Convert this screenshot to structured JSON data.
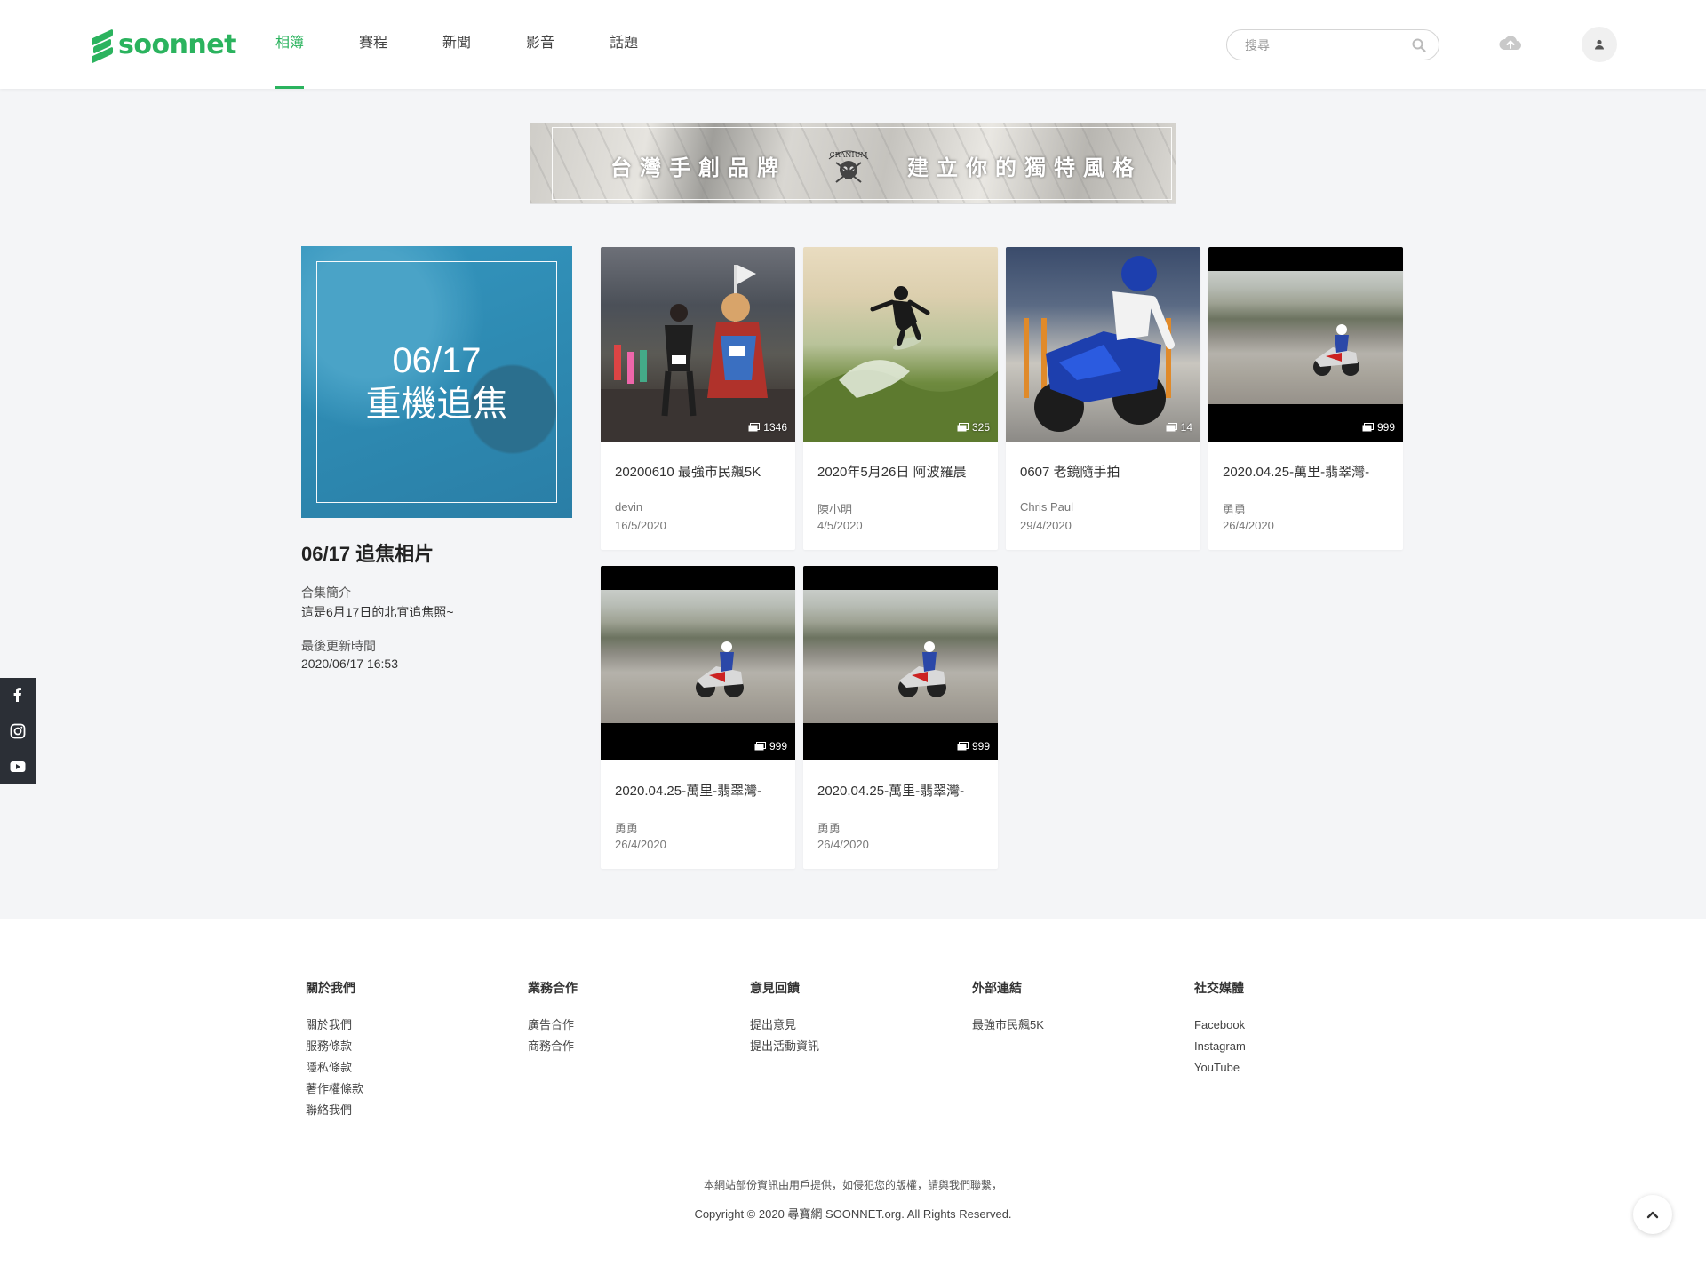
{
  "header": {
    "logo_text": "soonnet",
    "nav": [
      "相簿",
      "賽程",
      "新聞",
      "影音",
      "話題"
    ],
    "active_nav": "相簿",
    "search_placeholder": "搜尋",
    "accent_color": "#2bb35e"
  },
  "banner": {
    "left_text": "台灣手創品牌",
    "right_text": "建立你的獨特風格",
    "logo_text": "CRANIUM"
  },
  "album": {
    "cover_line1": "06/17",
    "cover_line2": "重機追焦",
    "title": "06/17 追焦相片",
    "intro_label": "合集簡介",
    "intro_text": "這是6月17日的北宜追焦照~",
    "updated_label": "最後更新時間",
    "updated_value": "2020/06/17 16:53"
  },
  "cards": [
    {
      "title": "20200610 最強市民飆5K",
      "author": "devin",
      "date": "16/5/2020",
      "count": "1346"
    },
    {
      "title": "2020年5月26日 阿波羅晨",
      "author": "陳小明",
      "date": "4/5/2020",
      "count": "325"
    },
    {
      "title": "0607 老鏡隨手拍",
      "author": "Chris Paul",
      "date": "29/4/2020",
      "count": "14"
    },
    {
      "title": "2020.04.25-萬里-翡翠灣-",
      "author": "勇勇",
      "date": "26/4/2020",
      "count": "999"
    },
    {
      "title": "2020.04.25-萬里-翡翠灣-",
      "author": "勇勇",
      "date": "26/4/2020",
      "count": "999"
    },
    {
      "title": "2020.04.25-萬里-翡翠灣-",
      "author": "勇勇",
      "date": "26/4/2020",
      "count": "999"
    }
  ],
  "social_sidebar": [
    "facebook-icon",
    "instagram-icon",
    "youtube-icon"
  ],
  "footer": {
    "columns": [
      {
        "heading": "關於我們",
        "links": [
          "關於我們",
          "服務條款",
          "隱私條款",
          "著作權條款",
          "聯絡我們"
        ]
      },
      {
        "heading": "業務合作",
        "links": [
          "廣告合作",
          "商務合作"
        ]
      },
      {
        "heading": "意見回饋",
        "links": [
          "提出意見",
          "提出活動資訊"
        ]
      },
      {
        "heading": "外部連結",
        "links": [
          "最強市民飆5K"
        ]
      },
      {
        "heading": "社交媒體",
        "links": [
          "Facebook",
          "Instagram",
          "YouTube"
        ]
      }
    ],
    "note": "本網站部份資訊由用戶提供，如侵犯您的版權，請與我們聯繫，",
    "copyright": "Copyright © 2020 尋寶網 SOONNET.org. All Rights Reserved."
  }
}
